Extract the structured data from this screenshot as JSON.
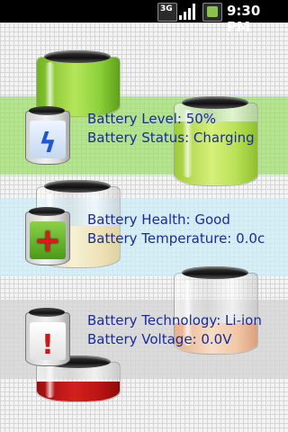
{
  "status_bar": {
    "network_type": "3G",
    "time": "9:30 PM",
    "icons": [
      "network-3g-icon",
      "signal-icon",
      "battery-app-icon"
    ]
  },
  "rows": [
    {
      "line1": "Battery Level: 50%",
      "line2": "Battery Status: Charging",
      "icon": "charging-icon",
      "band_color": "#9cde68"
    },
    {
      "line1": "Battery Health: Good",
      "line2": "Battery Temperature: 0.0c",
      "icon": "health-plus-icon",
      "band_color": "#cdecf6"
    },
    {
      "line1": "Battery Technology: Li-ion",
      "line2": "Battery Voltage: 0.0V",
      "icon": "warning-icon",
      "band_color": "#d4d4d4"
    }
  ],
  "colors": {
    "text": "#1a2b9c",
    "status_bar": "#000000"
  }
}
